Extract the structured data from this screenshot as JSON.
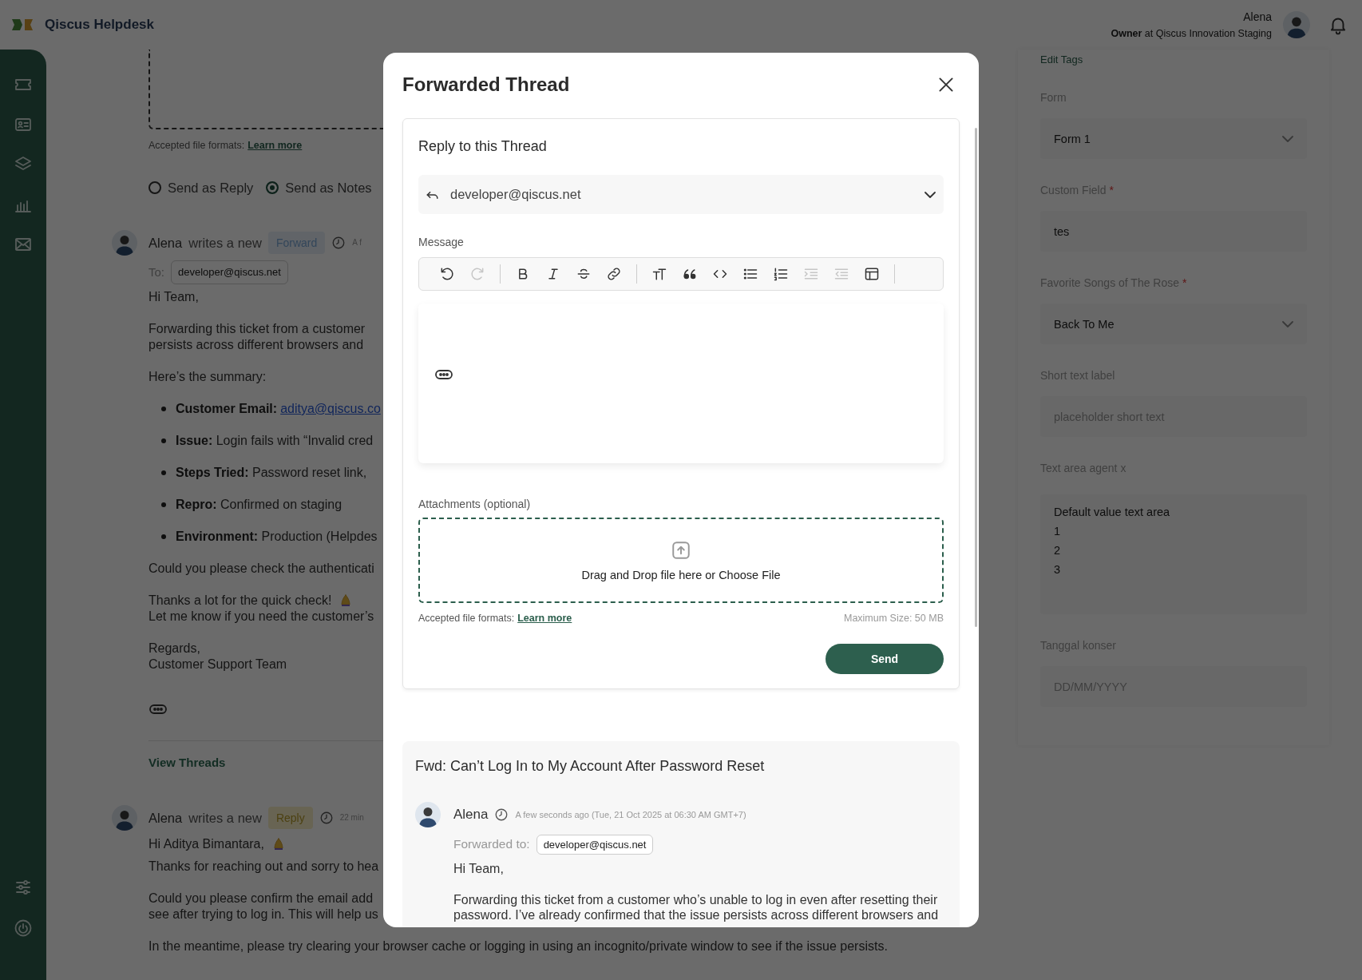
{
  "header": {
    "app_name": "Qiscus Helpdesk",
    "user": {
      "name": "Alena",
      "role": "**Owner** at Qiscus Innovation Staging"
    }
  },
  "composer": {
    "accepted_formats": "Accepted file formats:",
    "learn_more": "Learn more",
    "send_modes": [
      {
        "label": "Send as Reply",
        "selected": false
      },
      {
        "label": "Send as Notes",
        "selected": true
      }
    ]
  },
  "messages": [
    {
      "kind": "forward",
      "author": "Alena",
      "action": "writes a new",
      "badge": "Forward",
      "time": "A f",
      "to_label": "To:",
      "to": "developer@qiscus.net",
      "quote_toggle": true,
      "view_threads": "View Threads",
      "body": [
        {
          "kind": "paragraph",
          "lines": [
            "Hi Team,"
          ]
        },
        {
          "kind": "paragraph",
          "lines": [
            "Forwarding this ticket from a customer",
            "persists across different browsers and"
          ]
        },
        {
          "kind": "paragraph",
          "lines": [
            "Here’s the summary:"
          ]
        },
        {
          "kind": "bullets",
          "items": [
            {
              "label": "Customer Email:",
              "link": "aditya@qiscus.co"
            },
            {
              "label": "Issue:",
              "text": "Login fails with “Invalid cred"
            },
            {
              "label": "Steps Tried:",
              "text": "Password reset link,"
            },
            {
              "label": "Repro:",
              "text": "Confirmed on staging"
            },
            {
              "label": "Environment:",
              "text": "Production (Helpdes"
            }
          ]
        },
        {
          "kind": "paragraph",
          "lines": [
            "Could you please check the authenticati"
          ]
        },
        {
          "kind": "lines",
          "lines": [
            {
              "text": "Thanks a lot for the quick check!",
              "emoji": true
            },
            {
              "text": "Let me know if you need the customer’s"
            }
          ]
        },
        {
          "kind": "lines",
          "lines": [
            {
              "text": "Regards,"
            },
            {
              "text": "Customer Support Team"
            }
          ]
        }
      ]
    },
    {
      "kind": "reply",
      "author": "Alena",
      "action": "writes a new",
      "badge": "Reply",
      "time": "22 min",
      "body": [
        {
          "kind": "lines",
          "lines": [
            {
              "text": "Hi Aditya Bimantara,",
              "emoji": true
            }
          ]
        },
        {
          "kind": "paragraph",
          "lines": [
            "Thanks for reaching out and sorry to hea"
          ]
        },
        {
          "kind": "paragraph",
          "lines": [
            "Could you please confirm the email add",
            "see after trying to log in. This will help us"
          ]
        },
        {
          "kind": "paragraph",
          "lines": [
            "In the meantime, please try clearing your browser cache or logging in using an incognito/private window to see if the issue persists."
          ]
        }
      ]
    }
  ],
  "side_panel": {
    "edit_tags": "Edit Tags",
    "fields": [
      {
        "kind": "select",
        "label": "Form",
        "value": "Form 1"
      },
      {
        "kind": "text",
        "label": "Custom Field",
        "required_mark": "*",
        "value": "tes"
      },
      {
        "kind": "select",
        "label": "Favorite Songs of The Rose",
        "required_mark": "*",
        "value": "Back To Me"
      },
      {
        "kind": "text",
        "label": "Short text label",
        "placeholder": "placeholder short text"
      },
      {
        "kind": "textarea",
        "label": "Text area agent x",
        "value": "Default value text area\n1\n2\n3"
      },
      {
        "kind": "text",
        "label": "Tanggal konser",
        "placeholder": "DD/MM/YYYY"
      }
    ]
  },
  "modal": {
    "title": "Forwarded Thread",
    "reply_card": {
      "title": "Reply to this Thread",
      "recipient": "developer@qiscus.net",
      "message_label": "Message",
      "toolbar": [
        {
          "kind": "undo",
          "disabled": false
        },
        {
          "kind": "redo",
          "disabled": true
        },
        {
          "kind": "separator"
        },
        {
          "kind": "bold",
          "disabled": false
        },
        {
          "kind": "italic",
          "disabled": false
        },
        {
          "kind": "strike",
          "disabled": false
        },
        {
          "kind": "link",
          "disabled": false
        },
        {
          "kind": "separator"
        },
        {
          "kind": "textsize",
          "disabled": false
        },
        {
          "kind": "quote",
          "disabled": false
        },
        {
          "kind": "code",
          "disabled": false
        },
        {
          "kind": "bullets",
          "disabled": false
        },
        {
          "kind": "numbers",
          "disabled": false
        },
        {
          "kind": "indent",
          "disabled": true
        },
        {
          "kind": "outdent",
          "disabled": true
        },
        {
          "kind": "table",
          "disabled": false
        },
        {
          "kind": "separator"
        }
      ],
      "attachments_label": "Attachments (optional)",
      "dropzone_text": "Drag and Drop file here or Choose File",
      "accepted_formats": "Accepted file formats:",
      "learn_more": "Learn more",
      "max_size": "Maximum Size: 50 MB",
      "send": "Send"
    },
    "forwarded": {
      "subject": "Fwd: Can’t Log In to My Account After Password Reset",
      "author": "Alena",
      "time": "A few seconds ago (Tue, 21 Oct 2025 at 06:30 AM GMT+7)",
      "to_label": "Forwarded to:",
      "to": "developer@qiscus.net",
      "greeting": "Hi Team,",
      "body": "Forwarding this ticket from a customer who’s unable to log in even after resetting their password. I’ve already confirmed that the issue persists across different browsers and"
    }
  }
}
